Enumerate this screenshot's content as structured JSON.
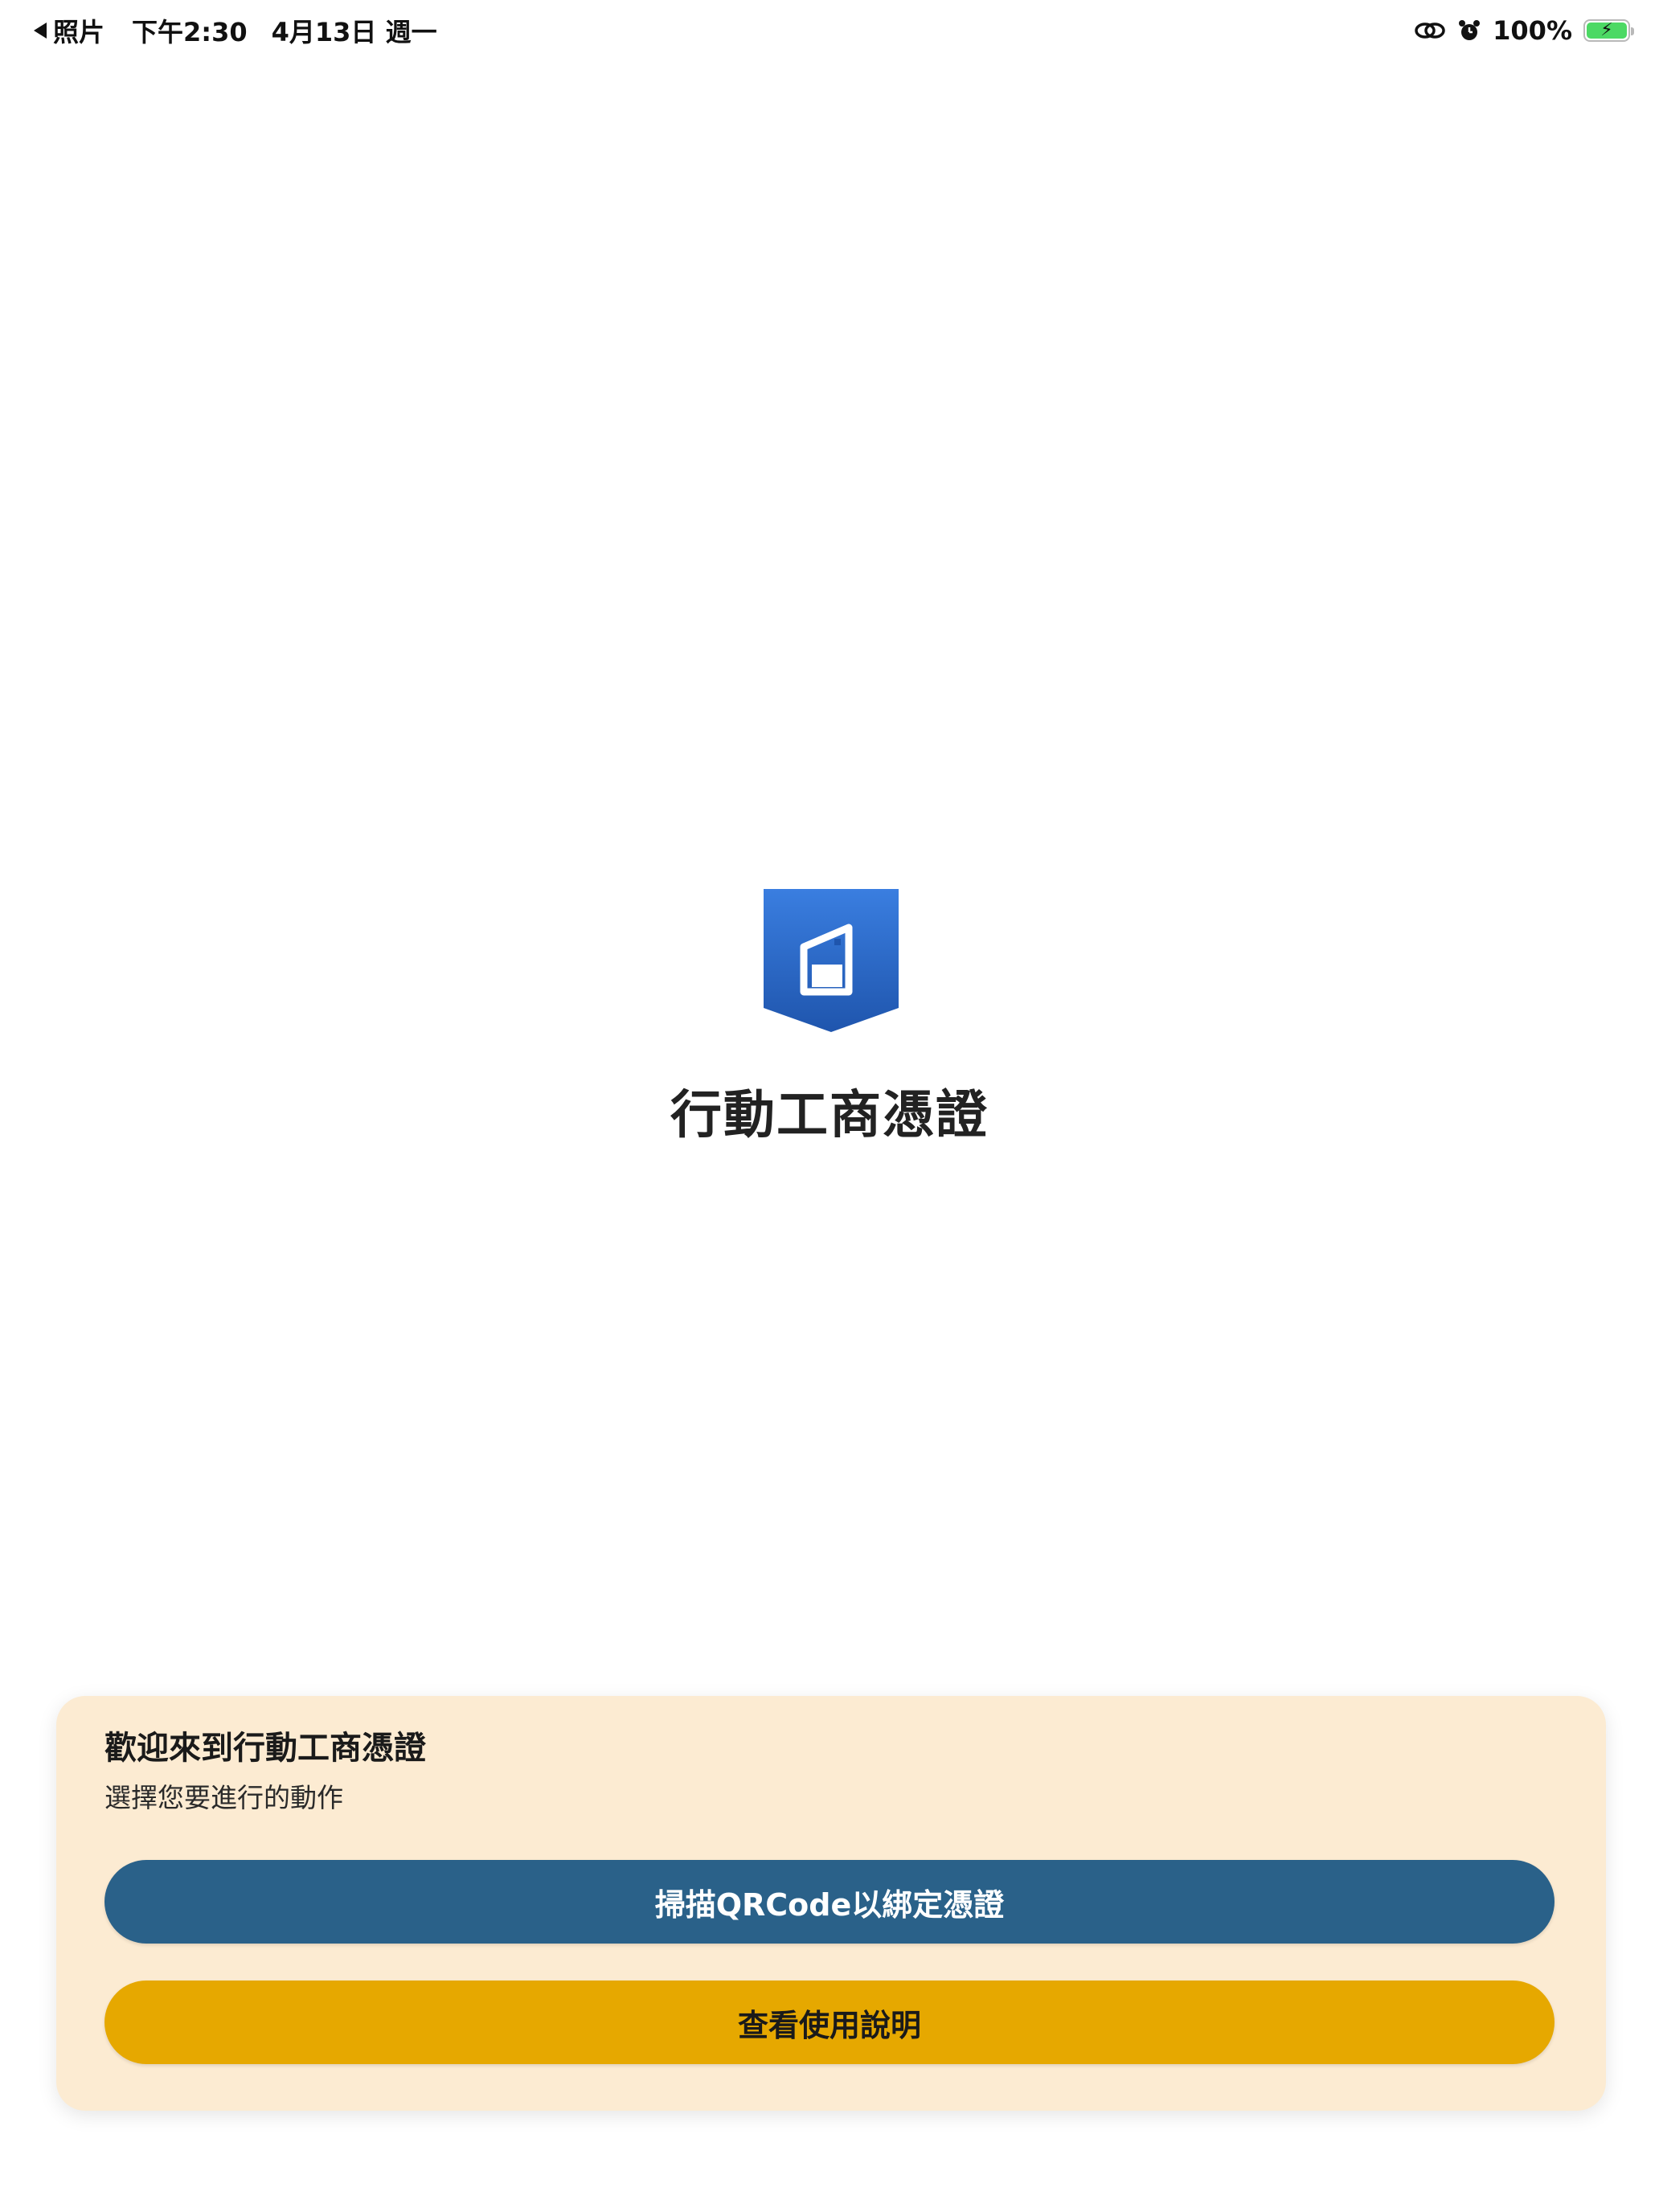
{
  "status_bar": {
    "back_app": "照片",
    "time": "下午2:30",
    "date": "4月13日 週一",
    "battery_percent": "100%",
    "battery_level": 1.0,
    "battery_color": "#4cd964",
    "icons": [
      "back-arrow-icon",
      "link-icon",
      "alarm-icon",
      "battery-icon",
      "charging-bolt-icon"
    ]
  },
  "splash": {
    "logo_icon": "app-logo-shield-icon",
    "title": "行動工商憑證"
  },
  "welcome_card": {
    "heading": "歡迎來到行動工商憑證",
    "subheading": "選擇您要進行的動作",
    "scan_button_label": "掃描QRCode以綁定憑證",
    "guide_button_label": "查看使用說明"
  },
  "colors": {
    "card_background": "#fcebd2",
    "primary_button": "#2a6189",
    "secondary_button": "#e6a800",
    "logo_blue": "#2d6fce"
  }
}
